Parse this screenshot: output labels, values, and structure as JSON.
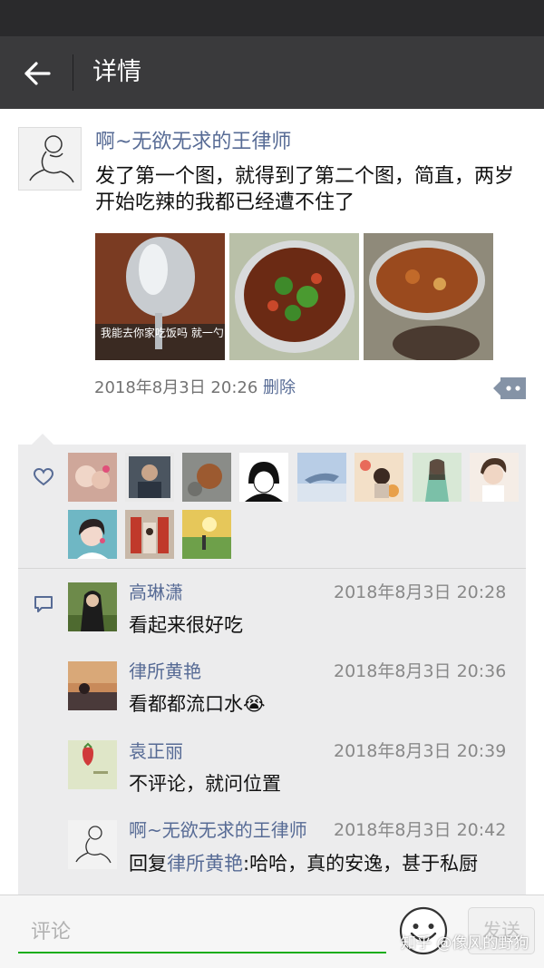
{
  "header": {
    "title": "详情",
    "back_icon": "arrow-left-icon"
  },
  "post": {
    "author": "啊~无欲无求的王律师",
    "text": "发了第一个图，就得到了第二个图，简直，两岁开始吃辣的我都已经遭不住了",
    "photos": [
      {
        "caption": "我能去你家吃饭吗  就一勺"
      },
      {
        "caption": ""
      },
      {
        "caption": ""
      }
    ],
    "time": "2018年8月3日 20:26",
    "delete_label": "删除",
    "more_icon": "more-dots-icon"
  },
  "likes": {
    "icon": "heart-outline-icon",
    "count_avatars": 11
  },
  "comments": [
    {
      "name": "高琳潇",
      "time": "2018年8月3日 20:28",
      "text": "看起来很好吃"
    },
    {
      "name": "律所黄艳",
      "time": "2018年8月3日 20:36",
      "text": "看都都流口水",
      "emoji": "😭"
    },
    {
      "name": "袁正丽",
      "time": "2018年8月3日 20:39",
      "text": "不评论，就问位置"
    },
    {
      "name": "啊~无欲无求的王律师",
      "time": "2018年8月3日 20:42",
      "reply_prefix": "回复",
      "reply_to": "律所黄艳",
      "text": ":哈哈，真的安逸，甚于私厨"
    }
  ],
  "comment_bar": {
    "placeholder": "评论",
    "send_label": "发送",
    "emoji_icon": "smiley-icon"
  },
  "watermark": "知乎 @像风的野狗",
  "colors": {
    "link": "#576b95",
    "header_bg": "#3a3a3c",
    "panel_bg": "#ececed",
    "input_accent": "#1aad19"
  }
}
